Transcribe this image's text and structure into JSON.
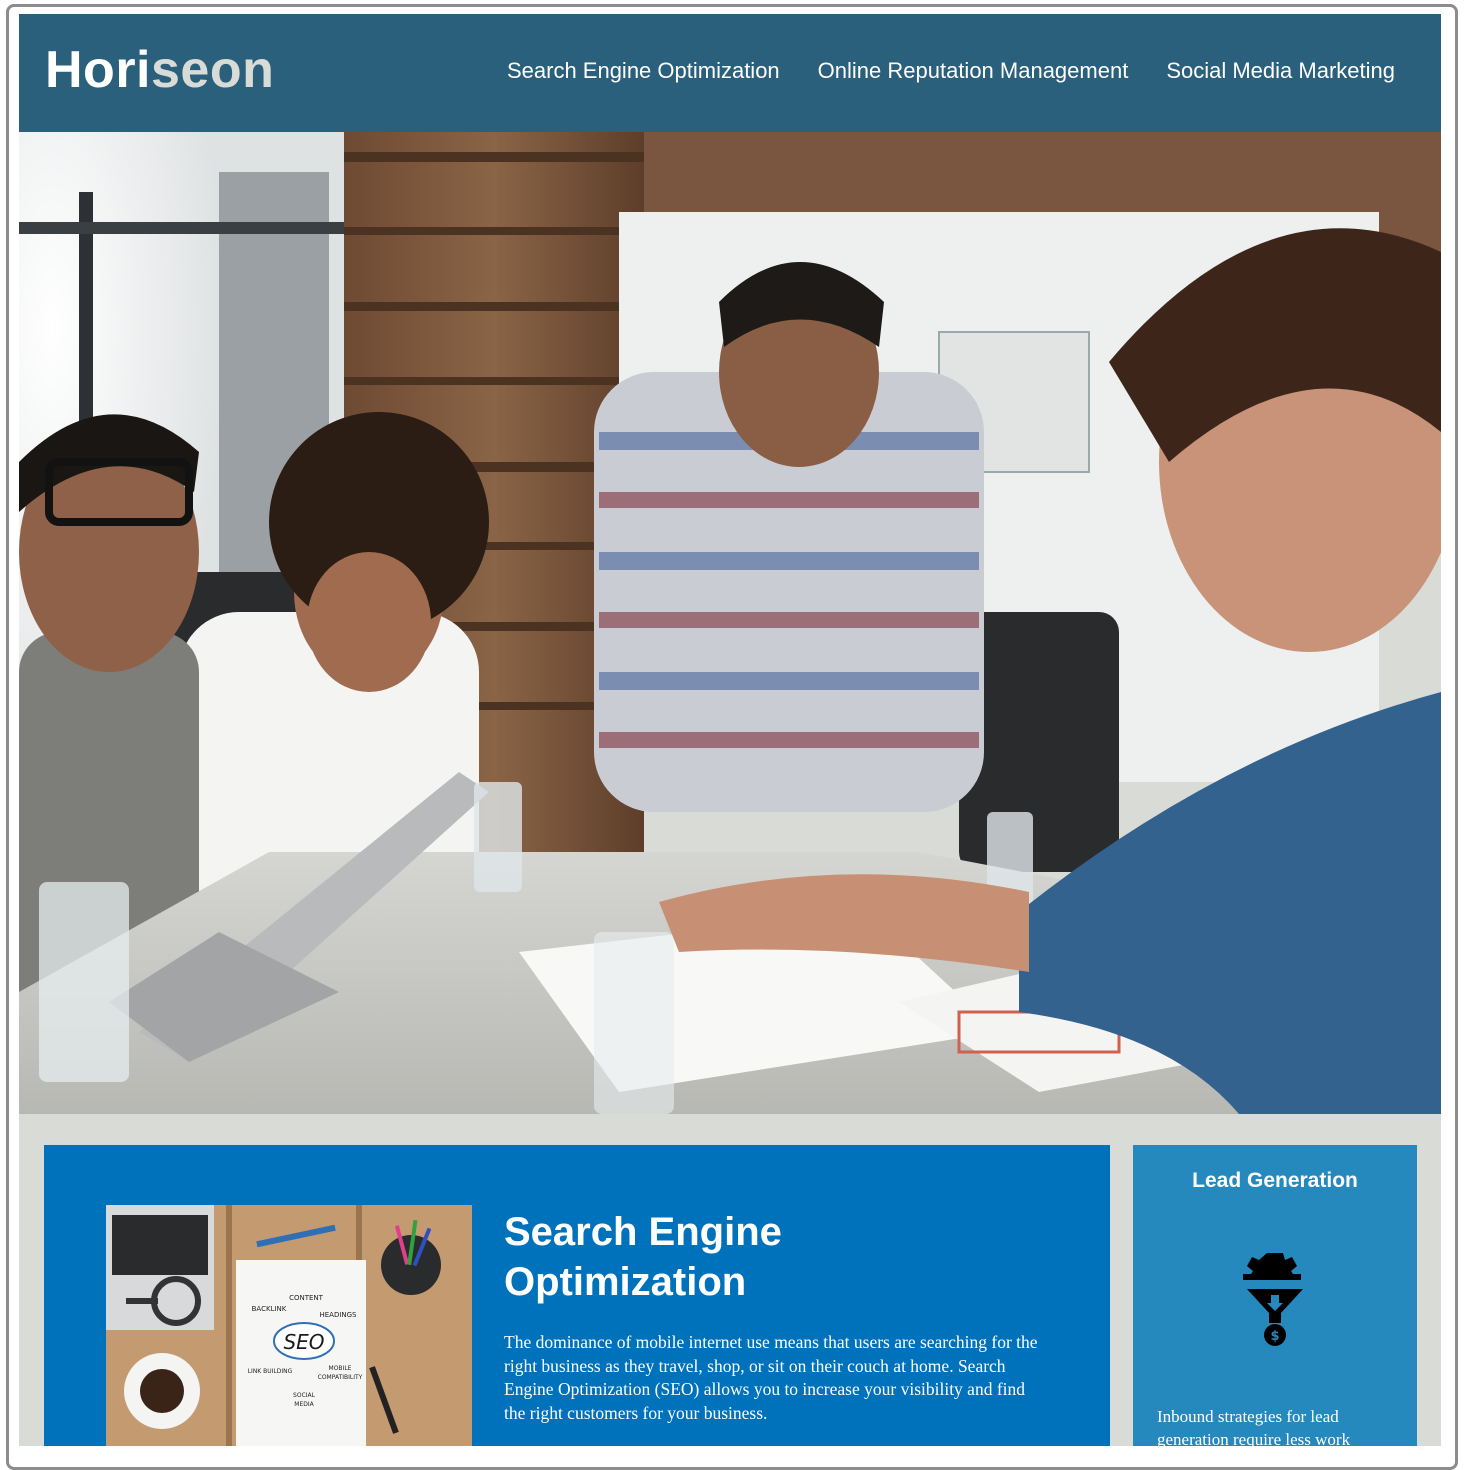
{
  "header": {
    "logo_main": "Hori",
    "logo_accent": "seon",
    "nav": [
      {
        "label": "Search Engine Optimization"
      },
      {
        "label": "Online Reputation Management"
      },
      {
        "label": "Social Media Marketing"
      }
    ]
  },
  "hero": {
    "icon": "hero-photo-team-meeting"
  },
  "seo": {
    "title": "Search Engine Optimization",
    "text": "The dominance of mobile internet use means that users are searching for the right business as they travel, shop, or sit on their couch at home. Search Engine Optimization (SEO) allows you to increase your visibility and find the right customers for your business.",
    "image_labels": {
      "center": "SEO",
      "content": "CONTENT",
      "backlink": "BACKLINK",
      "headings": "HEADINGS",
      "link_building": "LINK BUILDING",
      "mobile": "MOBILE",
      "compatibility": "COMPATIBILITY",
      "social": "SOCIAL",
      "media": "MEDIA"
    }
  },
  "lead": {
    "title": "Lead Generation",
    "icon": "lead-funnel-icon",
    "text": "Inbound strategies for lead generation require less work"
  },
  "colors": {
    "header_bg": "#2a607c",
    "page_bg": "#d9dcd6",
    "seo_card_bg": "#0072bb",
    "lead_card_bg": "#2589bd"
  }
}
